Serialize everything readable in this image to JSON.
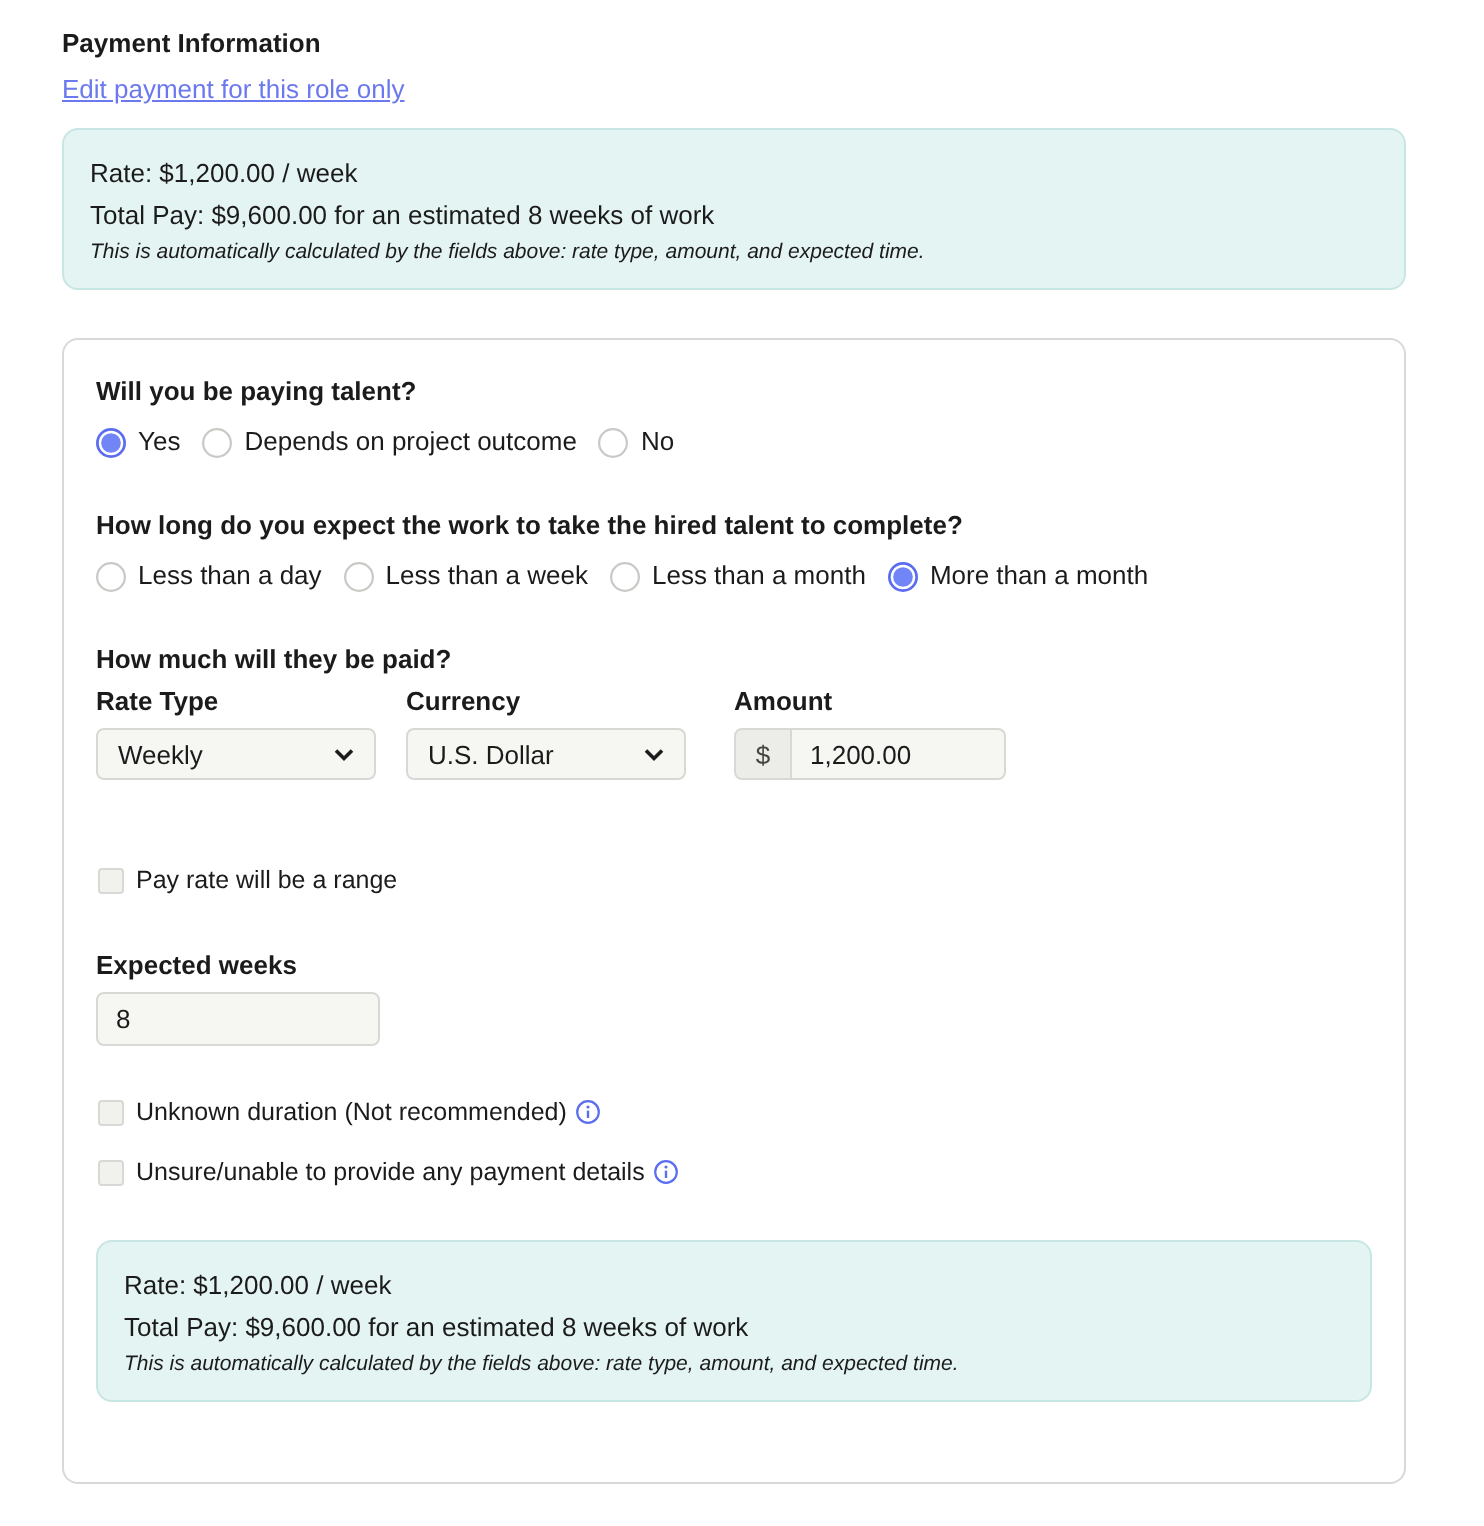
{
  "section": {
    "title": "Payment Information",
    "link": "Edit payment for this role only"
  },
  "summary": {
    "rate": "Rate: $1,200.00 / week",
    "total": "Total Pay: $9,600.00 for an estimated 8 weeks of work",
    "note": "This is automatically calculated by the fields above: rate type, amount, and expected time."
  },
  "form": {
    "questions": [
      {
        "question": "Will you be paying talent?",
        "options": [
          {
            "label": "Yes",
            "selected": true
          },
          {
            "label": "Depends on project outcome",
            "selected": false
          },
          {
            "label": "No",
            "selected": false
          }
        ]
      },
      {
        "question": "How long do you expect the work to take the hired talent to complete?",
        "options": [
          {
            "label": "Less than a day",
            "selected": false
          },
          {
            "label": "Less than a week",
            "selected": false
          },
          {
            "label": "Less than a month",
            "selected": false
          },
          {
            "label": "More than a month",
            "selected": true
          }
        ]
      }
    ],
    "payment": {
      "question": "How much will they be paid?",
      "fields": [
        {
          "kind": "select",
          "label": "Rate Type",
          "value": "Weekly"
        },
        {
          "kind": "select",
          "label": "Currency",
          "value": "U.S. Dollar"
        },
        {
          "kind": "amount",
          "label": "Amount",
          "prefix": "$",
          "value": "1,200.00"
        }
      ]
    },
    "range_option": {
      "label": "Pay rate will be a range",
      "checked": false
    },
    "expected_weeks": {
      "label": "Expected weeks",
      "value": "8"
    },
    "extra_options": [
      {
        "label": "Unknown duration (Not recommended)",
        "checked": false,
        "info": true
      },
      {
        "label": "Unsure/unable to provide any payment details",
        "checked": false,
        "info": true
      }
    ],
    "summary": {
      "rate": "Rate: $1,200.00 / week",
      "total": "Total Pay: $9,600.00 for an estimated 8 weeks of work",
      "note": "This is automatically calculated by the fields above: rate type, amount, and expected time."
    }
  }
}
